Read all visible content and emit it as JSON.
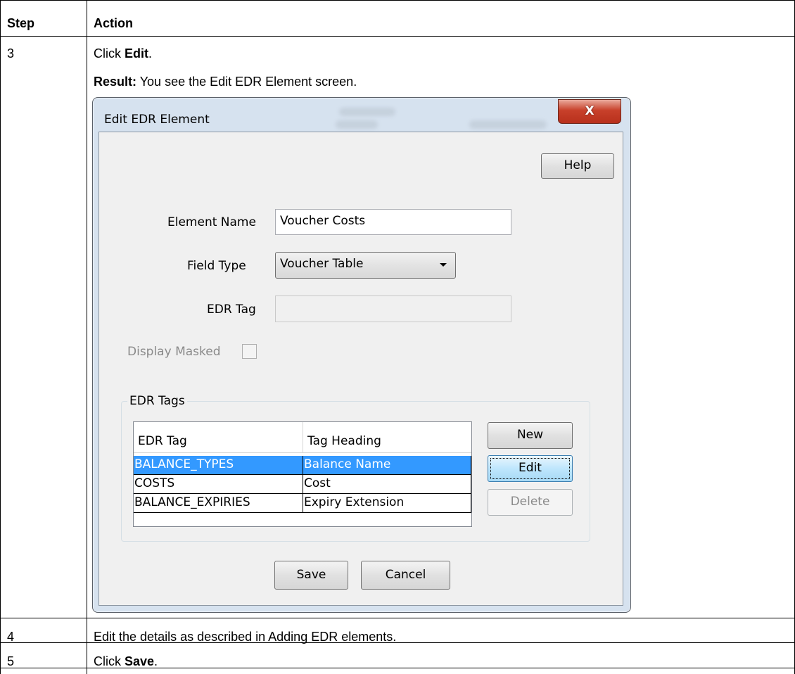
{
  "table": {
    "header": {
      "step": "Step",
      "action": "Action"
    },
    "row3": {
      "step": "3",
      "line1_prefix": "Click ",
      "line1_bold": "Edit",
      "line1_suffix": ".",
      "line2_bold": "Result:",
      "line2_rest": " You see the Edit EDR Element screen."
    },
    "row4": {
      "step": "4",
      "text": "Edit the details as described in Adding EDR elements."
    },
    "row5": {
      "step": "5",
      "prefix": "Click ",
      "bold": "Save",
      "suffix": "."
    }
  },
  "dialog": {
    "title": "Edit EDR Element",
    "close_label": "X",
    "help_label": "Help",
    "element_name_label": "Element Name",
    "element_name_value": "Voucher Costs",
    "field_type_label": "Field Type",
    "field_type_value": "Voucher Table",
    "edr_tag_label": "EDR Tag",
    "edr_tag_value": "",
    "display_masked_label": "Display Masked",
    "display_masked_checked": false,
    "group_label": "EDR Tags",
    "grid": {
      "columns": [
        "EDR Tag",
        "Tag Heading"
      ],
      "rows": [
        {
          "tag": "BALANCE_TYPES",
          "heading": "Balance Name",
          "selected": true
        },
        {
          "tag": "COSTS",
          "heading": "Cost",
          "selected": false
        },
        {
          "tag": "BALANCE_EXPIRIES",
          "heading": "Expiry Extension",
          "selected": false
        }
      ]
    },
    "new_label": "New",
    "edit_label": "Edit",
    "delete_label": "Delete",
    "save_label": "Save",
    "cancel_label": "Cancel"
  },
  "colors": {
    "selection": "#3399ff",
    "close_button": "#c8402a",
    "dialog_frame": "#d6e2ef"
  }
}
